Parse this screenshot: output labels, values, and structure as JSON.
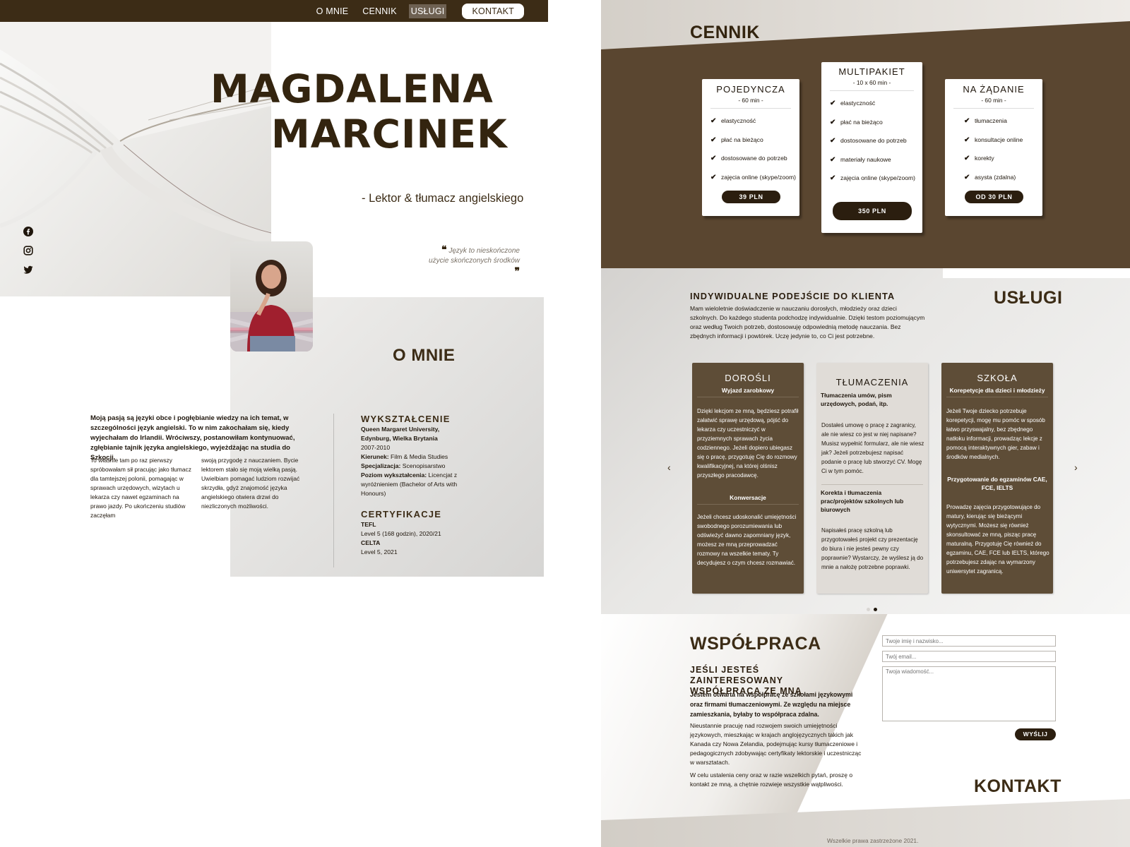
{
  "nav": {
    "items": [
      "O MNIE",
      "CENNIK",
      "USŁUGI"
    ],
    "cta": "KONTAKT"
  },
  "hero": {
    "name_line1": "MAGDALENA",
    "name_line2": "MARCINEK",
    "subtitle": "- Lektor & tłumacz angielskiego",
    "quote": "Język to nieskończone użycie skończonych środków"
  },
  "social": [
    "facebook-icon",
    "instagram-icon",
    "twitter-icon"
  ],
  "about": {
    "title": "O MNIE",
    "lead": "Moją pasją są języki obce i pogłębianie wiedzy na ich temat, w szczególności język angielski. To w nim zakochałam się, kiedy wyjechałam do Irlandii. Wróciwszy, postanowiłam kontynuować, zgłębianie tajnik języka angielskiego, wyjeżdżając na studia do Szkocji.",
    "col1": "To właśnie tam po raz pierwszy spróbowałam sił pracując jako tłumacz dla tamtejszej polonii, pomagając w sprawach urzędowych, wizytach u lekarza czy nawet egzaminach na prawo jazdy. Po ukończeniu studiów zaczęłam",
    "col2": "swoją przygodę z nauczaniem. Bycie lektorem stało się moją wielką pasją. Uwielbiam pomagać ludziom rozwijać skrzydła, gdyż znajomość języka angielskiego otwiera drzwi do niezliczonych możliwości.",
    "education": {
      "title": "WYKSZTAŁCENIE",
      "school": "Queen Margaret University, Edynburg, Wielka Brytania",
      "years": "2007-2010",
      "kierunek_label": "Kierunek:",
      "kierunek": "Film & Media Studies",
      "spec_label": "Specjalizacja:",
      "spec": "Scenopisarstwo",
      "level_label": "Poziom wykształcenia:",
      "level": "Licencjat z wyróżnieniem (Bachelor of Arts with Honours)"
    },
    "certs": {
      "title": "CERTYFIKACJE",
      "c1_name": "TEFL",
      "c1_detail": "Level 5 (168 godzin), 2020/21",
      "c2_name": "CELTA",
      "c2_detail": "Level 5, 2021"
    }
  },
  "pricing": {
    "title": "CENNIK",
    "cards": [
      {
        "name": "POJEDYNCZA",
        "duration": "- 60 min -",
        "features": [
          "elastyczność",
          "płać na bieżąco",
          "dostosowane do potrzeb",
          "zajęcia online (skype/zoom)"
        ],
        "price": "39 PLN"
      },
      {
        "name": "MULTIPAKIET",
        "duration": "- 10 x 60 min -",
        "features": [
          "elastyczność",
          "płać na bieżąco",
          "dostosowane do potrzeb",
          "materiały naukowe",
          "zajęcia online (skype/zoom)"
        ],
        "price": "350 PLN"
      },
      {
        "name": "NA ŻĄDANIE",
        "duration": "- 60 min -",
        "features": [
          "tłumaczenia",
          "konsultacje online",
          "korekty",
          "asysta (zdalna)"
        ],
        "price": "OD 30 PLN"
      }
    ]
  },
  "services": {
    "title": "USŁUGI",
    "intro_title": "INDYWIDUALNE PODEJŚCIE DO KLIENTA",
    "intro_text": "Mam wieloletnie doświadczenie w nauczaniu dorosłych, młodzieży oraz dzieci szkolnych. Do każdego studenta podchodzę indywidualnie. Dzięki testom poziomującym oraz według Twoich potrzeb, dostosowuję odpowiednią metodę nauczania. Bez zbędnych informacji i powtórek. Uczę jedynie to, co Ci jest potrzebne.",
    "cards": [
      {
        "title": "DOROŚLI",
        "sub1": "Wyjazd zarobkowy",
        "p1": "Dzięki lekcjom ze mną, będziesz potrafił załatwić sprawę urzędową, pójść do lekarza czy uczestniczyć w przyziemnych sprawach życia codziennego. Jeżeli dopiero ubiegasz się o pracę, przygotuję Cię do rozmowy kwalifikacyjnej, na której olśnisz przyszłego pracodawcę.",
        "sub2": "Konwersacje",
        "p2": "Jeżeli chcesz udoskonalić umiejętności swobodnego porozumiewania lub odświeżyć dawno zapomniany język, możesz ze mną przeprowadzać rozmowy na wszelkie tematy. Ty decydujesz o czym chcesz rozmawiać."
      },
      {
        "title": "TŁUMACZENIA",
        "sub1": "Tłumaczenia umów, pism urzędowych, podań, itp.",
        "p1": "Dostałeś umowę o pracę z zagranicy, ale nie wiesz co jest w niej napisane? Musisz wypełnić formularz, ale nie wiesz jak? Jeżeli potrzebujesz napisać podanie o pracę lub stworzyć CV. Mogę Ci w tym pomóc.",
        "sub2": "Korekta i tłumaczenia prac/projektów szkolnych lub biurowych",
        "p2": "Napisałeś pracę szkolną lub przygotowałeś projekt czy prezentację do biura i nie jesteś pewny czy poprawnie? Wystarczy, że wyślesz ją do mnie a nałożę potrzebne poprawki."
      },
      {
        "title": "SZKOŁA",
        "sub1": "Korepetycje dla dzieci i młodzieży",
        "p1": "Jeżeli Twoje dziecko potrzebuje korepetycji, mogę mu pomóc w sposób łatwo przyswajalny, bez zbędnego natłoku informacji, prowadząc lekcje z pomocą interaktywnych gier, zabaw i środków medialnych.",
        "sub2": "Przygotowanie do egzaminów CAE, FCE, IELTS",
        "p2": "Prowadzę zajęcia przygotowujące do matury, kierując się bieżącymi wytycznymi. Możesz się również skonsultować ze mną, pisząc pracę maturalną. Przygotuję Cię również do egzaminu, CAE, FCE lub IELTS, którego potrzebujesz zdając na wymarzony uniwersytet zagranicą."
      }
    ],
    "prev": "‹",
    "next": "›"
  },
  "cooperation": {
    "title": "WSPÓŁPRACA",
    "subtitle": "JEŚLI JESTEŚ ZAINTERESOWANY WSPÓŁPRACĄ ZE MNĄ",
    "lead": "Jestem otwarta na współpracę ze szkołami językowymi oraz firmami tłumaczeniowymi. Ze względu na miejsce zamieszkania, byłaby to współpraca zdalna.",
    "p1": "Nieustannie pracuję nad rozwojem swoich umiejętności językowych, mieszkając w krajach anglojęzycznych takich jak Kanada czy Nowa Zelandia, podejmując kursy tłumaczeniowe i pedagogicznych zdobywając certyfikaty lektorskie i uczestnicząc w warsztatach.",
    "p2": "W celu ustalenia ceny oraz w razie wszelkich pytań, proszę o kontakt ze mną, a chętnie rozwieje wszystkie wątpliwości."
  },
  "contact": {
    "title": "KONTAKT",
    "name_placeholder": "Twoje imię i nazwisko...",
    "email_placeholder": "Twój email...",
    "message_placeholder": "Twoja wiadomość...",
    "send": "WYŚLIJ"
  },
  "footer": "Wszelkie prawa zastrzeżone 2021.",
  "colors": {
    "brand_dark": "#3c2c16",
    "card_brown": "#5e4d37",
    "band_brown": "#5a4630"
  }
}
